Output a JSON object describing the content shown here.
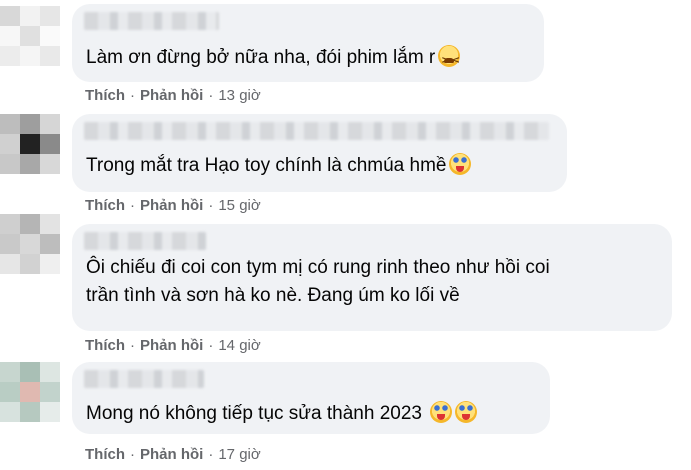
{
  "comments": [
    {
      "text": [
        "Làm ơn đừng bở nữa nha, đói phim lắm r"
      ],
      "emoji": [
        "tired-face-icon"
      ],
      "like": "Thích",
      "reply": "Phản hồi",
      "time": "13 giờ",
      "avatar_colors": [
        "#d8d8d8",
        "#f2f2f2",
        "#e6e6e6",
        "#f7f7f7",
        "#e0e0e0",
        "#fafafa",
        "#ececec",
        "#f5f5f5",
        "#e9e9e9"
      ]
    },
    {
      "text": [
        "Trong mắt tra Hạo toy chính là chmúa hmề"
      ],
      "emoji": [
        "clown-face-icon"
      ],
      "like": "Thích",
      "reply": "Phản hồi",
      "time": "15 giờ",
      "avatar_colors": [
        "#bdbdbd",
        "#9e9e9e",
        "#d6d6d6",
        "#d0d0d0",
        "#222222",
        "#8a8a8a",
        "#c8c8c8",
        "#a8a8a8",
        "#d8d8d8"
      ]
    },
    {
      "text": [
        "Ôi chiếu đi coi con tym mị có rung rinh theo như hồi coi",
        "trần tình và sơn hà ko nè. Đang úm ko lối về"
      ],
      "emoji": [],
      "like": "Thích",
      "reply": "Phản hồi",
      "time": "14 giờ",
      "avatar_colors": [
        "#cfcfcf",
        "#b5b5b5",
        "#e3e3e3",
        "#c9c9c9",
        "#d8d8d8",
        "#bdbdbd",
        "#e6e6e6",
        "#d2d2d2",
        "#efefef"
      ]
    },
    {
      "text": [
        "Mong nó không tiếp tục sửa thành 2023"
      ],
      "emoji": [
        "clown-face-icon",
        "clown-face-icon"
      ],
      "like": "Thích",
      "reply": "Phản hồi",
      "time": "17 giờ",
      "avatar_colors": [
        "#c7d6cf",
        "#a9bfb5",
        "#dde6e2",
        "#b9cdc4",
        "#e0b9b1",
        "#c2d3cc",
        "#d7e2de",
        "#b6c9c0",
        "#e6ecea"
      ]
    }
  ]
}
